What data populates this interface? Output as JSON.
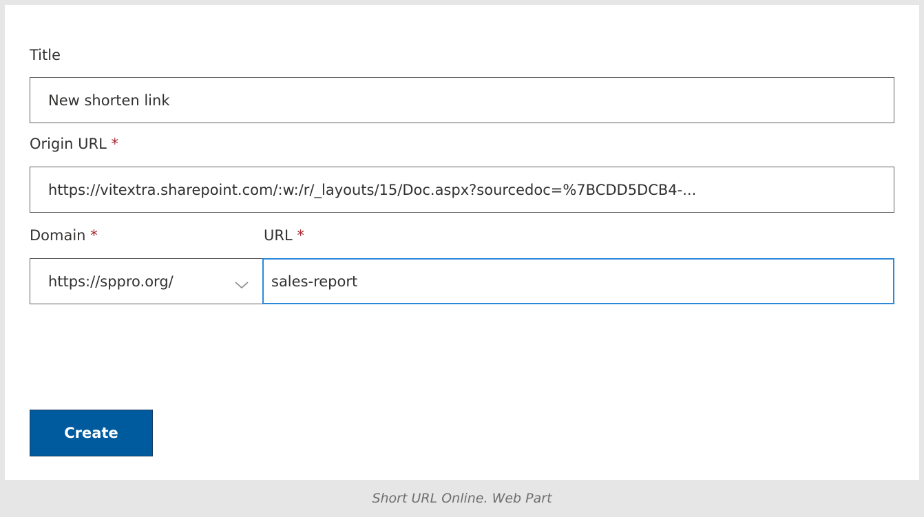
{
  "form": {
    "title_label": "Title",
    "title_value": "New shorten link",
    "origin_url_label": "Origin URL",
    "origin_url_value": "https://vitextra.sharepoint.com/:w:/r/_layouts/15/Doc.aspx?sourcedoc=%7BCDD5DCB4-...",
    "domain_label": "Domain",
    "domain_selected": "https://sppro.org/",
    "url_label": "URL",
    "url_value": "sales-report",
    "required_marker": "*",
    "create_button": "Create"
  },
  "footer": {
    "caption": "Short URL Online. Web Part"
  },
  "colors": {
    "accent": "#005a9e",
    "focus_border": "#2b88d8",
    "required": "#a4262c",
    "frame": "#e6e6e6"
  },
  "icons": {
    "domain_dropdown": "chevron-down-icon"
  }
}
